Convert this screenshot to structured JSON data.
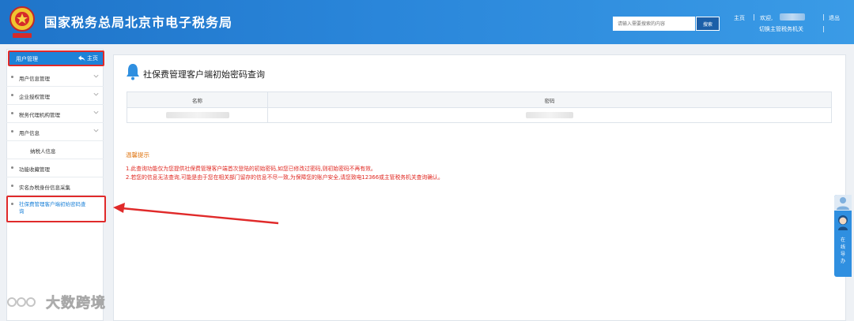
{
  "header": {
    "title": "国家税务总局北京市电子税务局",
    "search_placeholder": "请输入需要搜索的内容",
    "search_button": "搜索",
    "home_link": "主页",
    "welcome": "欢迎,",
    "logout": "退出",
    "switch_office": "切换主管税务机关",
    "sep": "|"
  },
  "sidebar": {
    "header_label": "用户管理",
    "home_label": "主页",
    "items": [
      {
        "label": "用户信息管理"
      },
      {
        "label": "企业授权管理"
      },
      {
        "label": "税务代理机构管理"
      },
      {
        "label": "用户信息"
      },
      {
        "label": "纳税人信息"
      },
      {
        "label": "功能收藏管理"
      },
      {
        "label": "实名办税身份信息采集"
      }
    ],
    "active_item": "社保费管理客户端初始密码查询"
  },
  "main": {
    "title": "社保费管理客户端初始密码查询",
    "table": {
      "columns": [
        "名称",
        "密码"
      ]
    },
    "tips_title": "温馨提示",
    "tips": [
      "1.此查询功能仅为您提供社保费管理客户端首次登陆的初始密码,如您已修改过密码,则初始密码不再有效。",
      "2.若您的信息无法查询,可能是由于您在相关部门留存的信息不尽一致,为保障您的账户安全,请您致电12366或主管税务机关查询确认。"
    ]
  },
  "float_service": {
    "label": "在线导办"
  },
  "watermark": {
    "text": "大数跨境"
  },
  "colors": {
    "header_blue": "#2a86da",
    "highlight_red": "#e02a2a",
    "tips_orange": "#e07a1a",
    "tips_red": "#e0261f"
  }
}
